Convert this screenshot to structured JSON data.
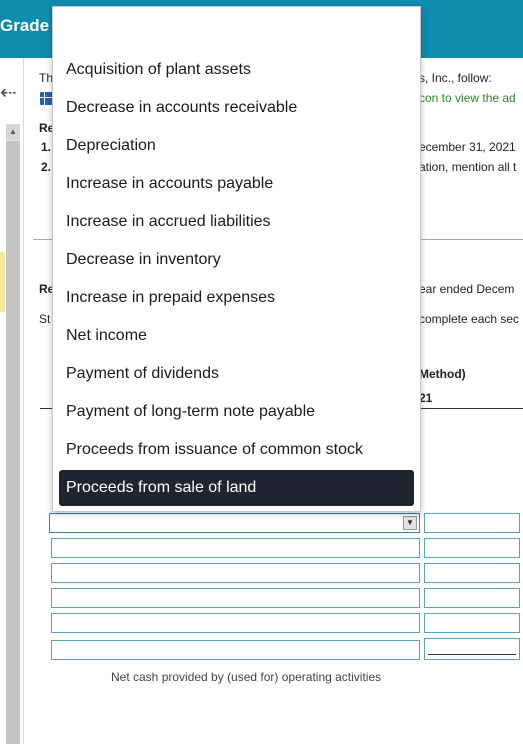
{
  "header": {
    "title": "Grade"
  },
  "background": {
    "intro_fragment": "Th",
    "intro_tail": "s, Inc., follow:",
    "icon_link_tail": "con to view the ad",
    "req_fragment": "Re",
    "req1_num": "1.",
    "req1_tail": "ecember 31, 2021",
    "req2_num": "2.",
    "req2_tail": "ation, mention all t",
    "section_fragment": "Re",
    "section_tail": "ear ended Decem",
    "st_fragment": "St",
    "st_tail": "complete each sec",
    "method_tail": "Method)",
    "year_tail": "21"
  },
  "dropdown": {
    "options": [
      "Acquisition of plant assets",
      "Decrease in accounts receivable",
      "Depreciation",
      "Increase in accounts payable",
      "Increase in accrued liabilities",
      "Decrease in inventory",
      "Increase in prepaid expenses",
      "Net income",
      "Payment of dividends",
      "Payment of long-term note payable",
      "Proceeds from issuance of common stock",
      "Proceeds from sale of land"
    ],
    "selected": "Proceeds from sale of land"
  },
  "form": {
    "footer_label": "Net cash provided by (used for) operating activities"
  },
  "icons": {
    "back": "back-arrow-icon",
    "table": "grid-table-icon",
    "dropdown_caret": "caret-down-icon"
  },
  "colors": {
    "header_bg": "#0e8cad",
    "selected_option_bg": "#1f2430",
    "link_green": "#2a8a2a"
  }
}
